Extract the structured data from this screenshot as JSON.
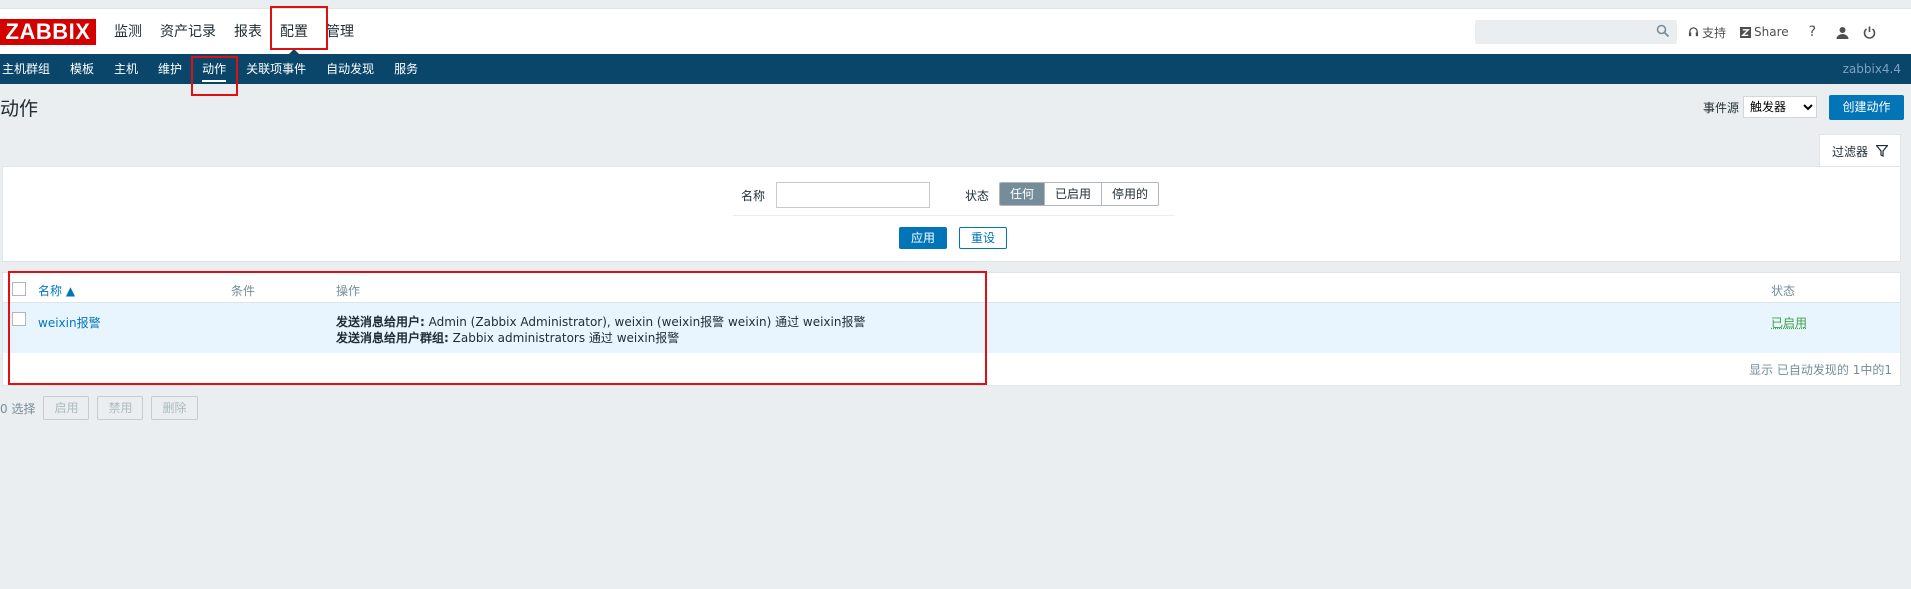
{
  "brand": {
    "logo": "ZABBIX"
  },
  "main_menu": [
    "监测",
    "资产记录",
    "报表",
    "配置",
    "管理"
  ],
  "main_menu_selected": "配置",
  "header_tools": {
    "support": "支持",
    "share": "Share",
    "help": "?"
  },
  "sub_menu": [
    "主机群组",
    "模板",
    "主机",
    "维护",
    "动作",
    "关联项事件",
    "自动发现",
    "服务"
  ],
  "sub_menu_selected": "动作",
  "version": "zabbix4.4",
  "page": {
    "title": "动作",
    "event_source_label": "事件源",
    "event_source_value": "触发器",
    "create_button": "创建动作"
  },
  "filter": {
    "tab_label": "过滤器",
    "name_label": "名称",
    "name_value": "",
    "status_label": "状态",
    "status_options": [
      "任何",
      "已启用",
      "停用的"
    ],
    "status_selected": "任何",
    "apply": "应用",
    "reset": "重设"
  },
  "table": {
    "headers": {
      "name": "名称 ▲",
      "conditions": "条件",
      "operations": "操作",
      "status": "状态"
    },
    "rows": [
      {
        "name": "weixin报警",
        "conditions": "",
        "operations": [
          {
            "label": "发送消息给用户:",
            "text": " Admin (Zabbix Administrator), weixin (weixin报警 weixin) 通过 weixin报警"
          },
          {
            "label": "发送消息给用户群组:",
            "text": " Zabbix administrators 通过 weixin报警"
          }
        ],
        "status": "已启用"
      }
    ],
    "footer": "显示 已自动发现的 1中的1"
  },
  "mass_actions": {
    "selected": "0 选择",
    "enable": "启用",
    "disable": "禁用",
    "delete": "删除"
  },
  "colors": {
    "brand_red": "#d40000",
    "nav_blue": "#0a466a",
    "link_blue": "#0275b8",
    "enabled_green": "#429e47",
    "annotation_red": "#e01010"
  }
}
